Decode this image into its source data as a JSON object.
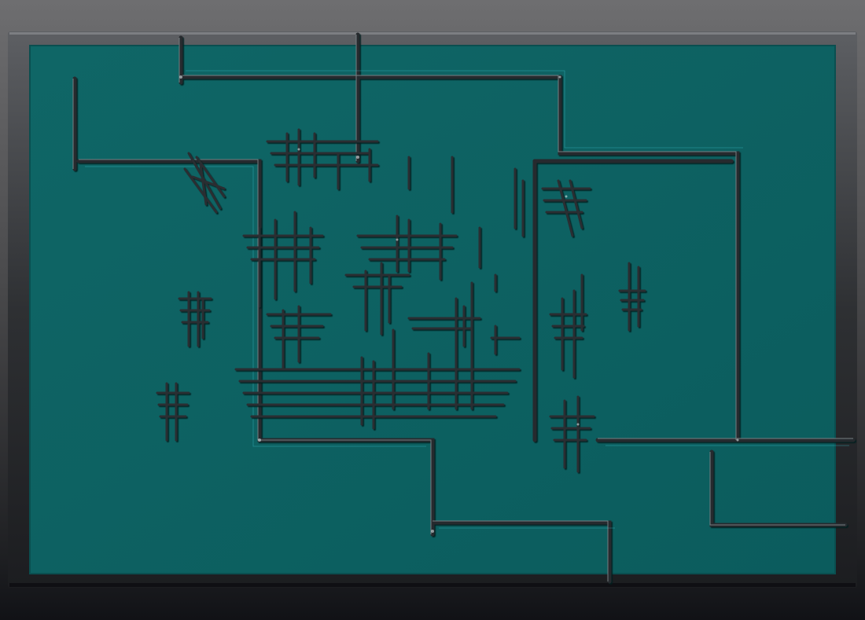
{
  "colors": {
    "background_top": "#6e6e70",
    "background_bottom": "#111216",
    "frame": "#2e2f32",
    "frame_highlight": "#8a8c90",
    "board": "#0e6161",
    "board_edge": "#0a4f50",
    "trace": "#2a2d30",
    "trace_highlight": "#b9c3c6",
    "trace_glow": "#3ec7d3"
  },
  "scene": {
    "description_visible_text": ""
  }
}
